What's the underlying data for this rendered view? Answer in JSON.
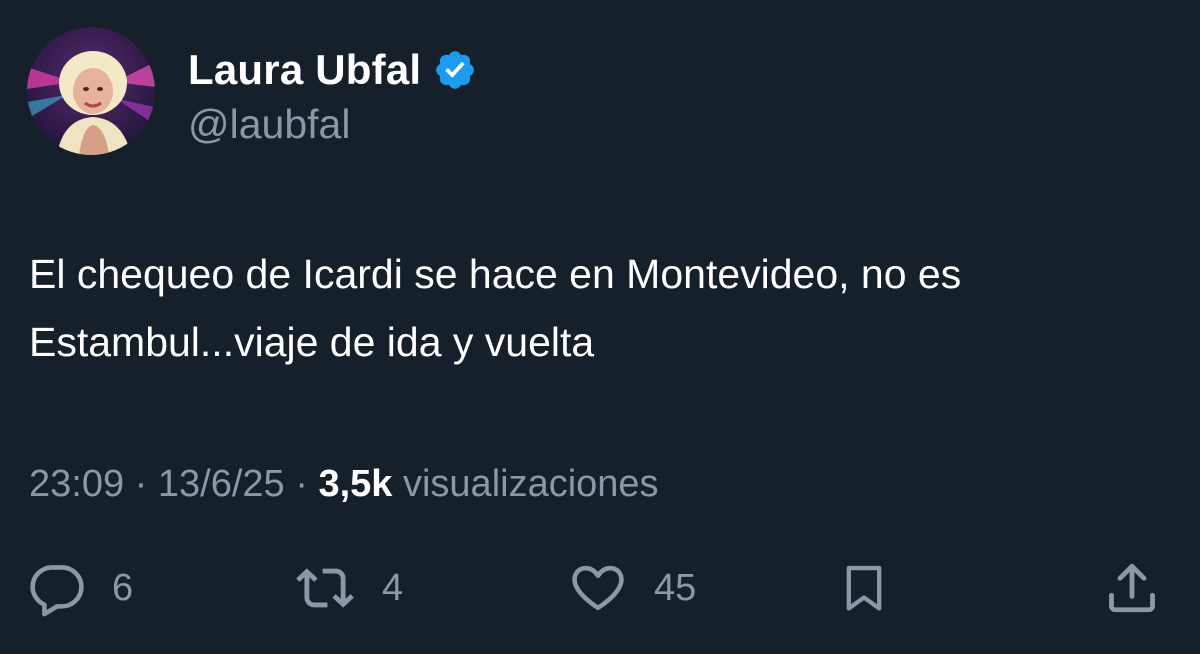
{
  "tweet": {
    "author": {
      "display_name": "Laura Ubfal",
      "handle": "@laubfal",
      "verified": true,
      "avatar_icon": "profile-photo"
    },
    "text": "El chequeo de Icardi se hace en Montevideo, no es Estambul...viaje de ida y vuelta",
    "meta": {
      "time": "23:09",
      "separator": " · ",
      "date": "13/6/25",
      "views_count": "3,5k",
      "views_label": " visualizaciones"
    },
    "actions": {
      "reply_count": "6",
      "retweet_count": "4",
      "like_count": "45",
      "reply_icon": "reply-icon",
      "retweet_icon": "retweet-icon",
      "like_icon": "heart-icon",
      "bookmark_icon": "bookmark-icon",
      "share_icon": "share-icon"
    }
  },
  "colors": {
    "background": "#15202b",
    "primary_text": "#ffffff",
    "secondary_text": "#8b98a5",
    "verified_badge": "#1d9bf0"
  }
}
